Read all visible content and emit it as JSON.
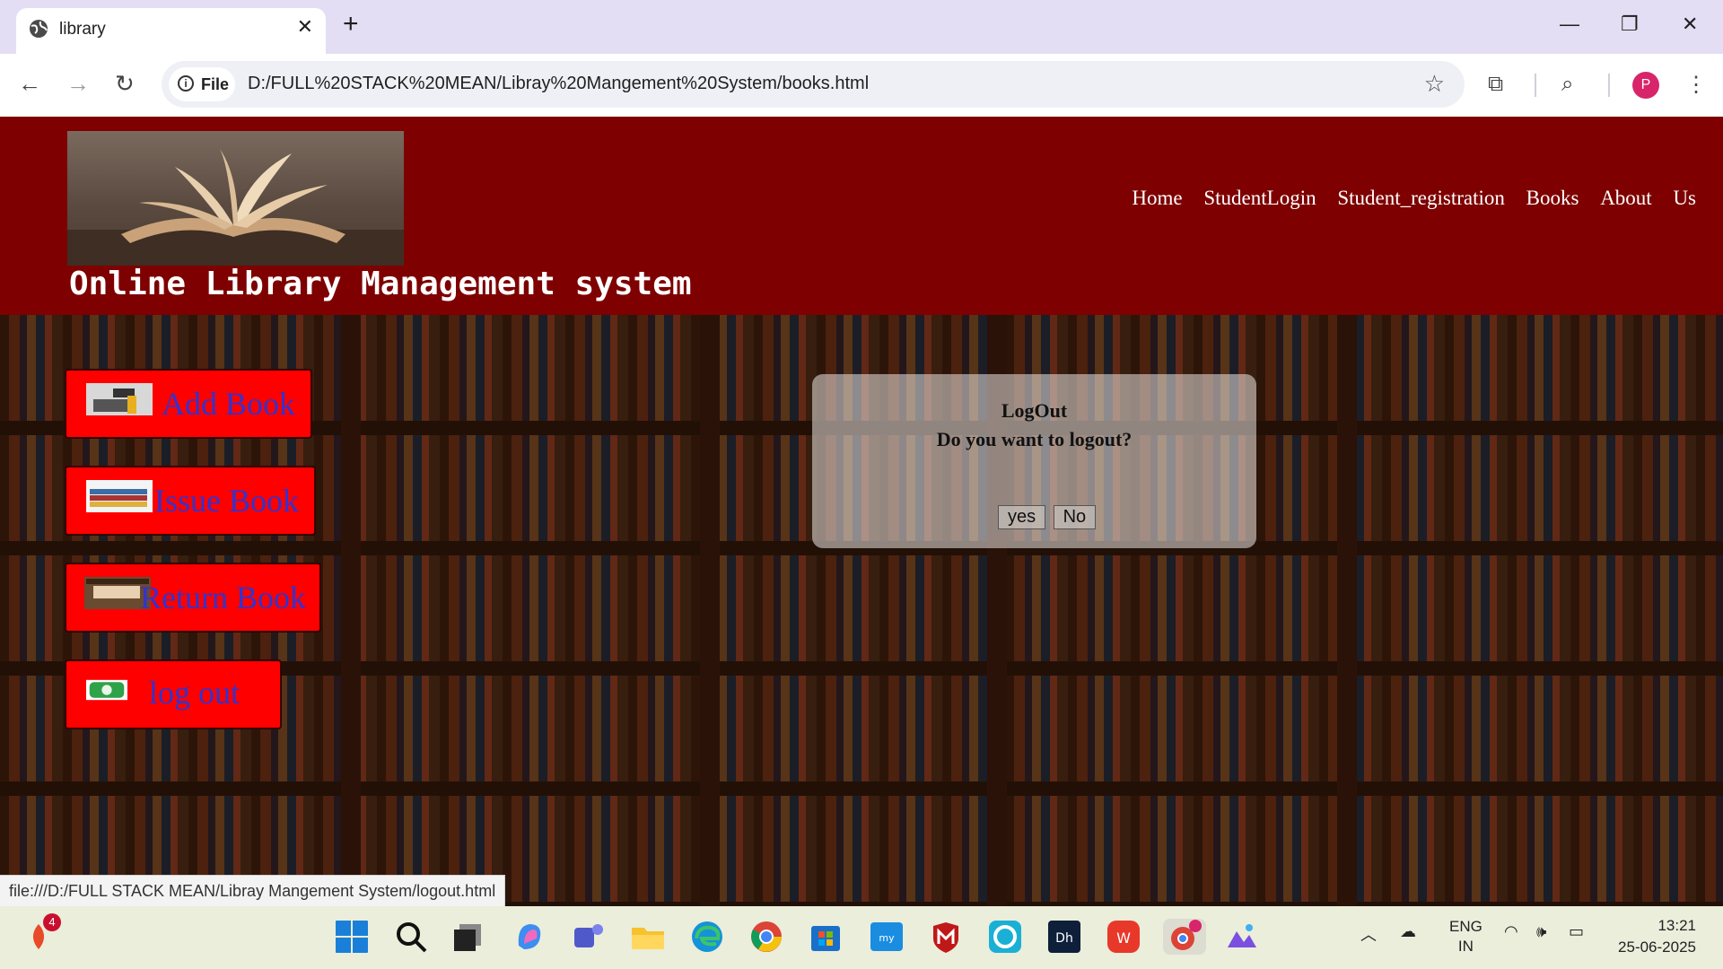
{
  "browser": {
    "tab_title": "library",
    "new_tab_symbol": "+",
    "url_chip_label": "File",
    "url": "D:/FULL%20STACK%20MEAN/Libray%20Mangement%20System/books.html",
    "profile_initial": "P",
    "status_url": "file:///D:/FULL STACK MEAN/Libray Mangement System/logout.html"
  },
  "header": {
    "site_title": "Online Library Management system",
    "nav": [
      "Home",
      "StudentLogin",
      "Student_registration",
      "Books",
      "About",
      "Us"
    ]
  },
  "menu": {
    "add_book": "Add Book",
    "issue_book": "Issue Book",
    "return_book": "Return Book",
    "log_out": "log out"
  },
  "dialog": {
    "title": "LogOut",
    "message": "Do you want to logout?",
    "yes": "yes",
    "no": "No"
  },
  "taskbar": {
    "notification_count": "4",
    "lang_top": "ENG",
    "lang_bottom": "IN",
    "time": "13:21",
    "date": "25-06-2025"
  },
  "colors": {
    "header_bg": "#7e0000",
    "menu_button_bg": "#ff0000",
    "menu_button_text": "#3333cc"
  }
}
